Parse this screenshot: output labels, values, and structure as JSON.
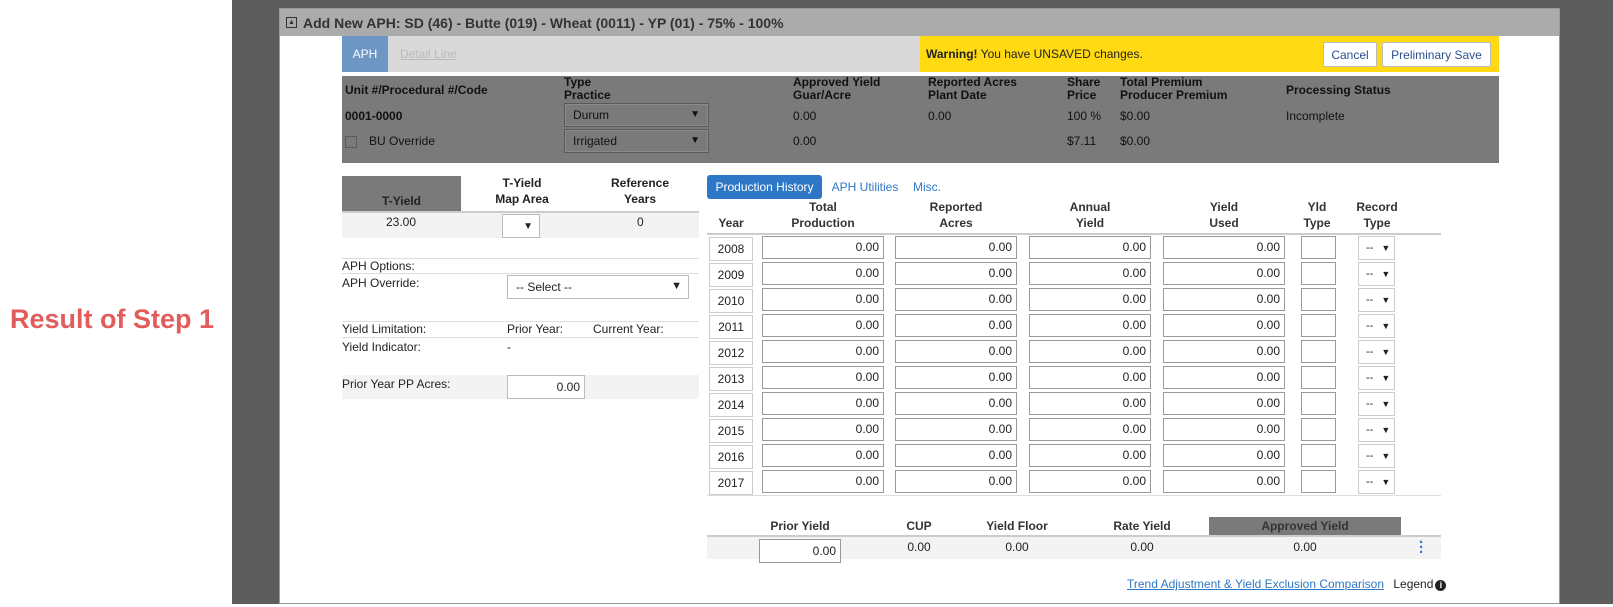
{
  "annotation": {
    "label": "Result of Step 1"
  },
  "modal": {
    "title": "Add New APH: SD (46) - Butte (019) - Wheat (0011) - YP (01) - 75% - 100%"
  },
  "tabs": {
    "aph": "APH",
    "detail_line": "Detail Line"
  },
  "warning": {
    "prefix": "Warning!",
    "message": "You have UNSAVED changes.",
    "cancel": "Cancel",
    "preliminary_save": "Preliminary Save"
  },
  "info": {
    "headers": {
      "unit": "Unit #/Procedural #/Code",
      "type": "Type",
      "practice": "Practice",
      "approved_yield": "Approved Yield",
      "guar_acre": "Guar/Acre",
      "reported_acres": "Reported Acres",
      "plant_date": "Plant Date",
      "share": "Share",
      "price": "Price",
      "total_premium": "Total Premium",
      "producer_premium": "Producer Premium",
      "processing_status": "Processing Status"
    },
    "unit_value": "0001-0000",
    "bu_override": "BU Override",
    "type_value": "Durum",
    "practice_value": "Irrigated",
    "approved_yield": "0.00",
    "guar_acre": "0.00",
    "reported_acres": "0.00",
    "share": "100 %",
    "price": "$7.11",
    "total_premium": "$0.00",
    "producer_premium": "$0.00",
    "processing_status": "Incomplete"
  },
  "left": {
    "t_yield_label": "T-Yield",
    "map_area_l1": "T-Yield",
    "map_area_l2": "Map Area",
    "ref_l1": "Reference",
    "ref_l2": "Years",
    "t_yield_value": "23.00",
    "ref_years_value": "0",
    "aph_options": "APH Options:",
    "aph_override": "APH Override:",
    "select_placeholder": "-- Select --",
    "yield_limitation": "Yield Limitation:",
    "prior_year": "Prior Year:",
    "current_year": "Current Year:",
    "yield_indicator": "Yield Indicator:",
    "yield_indicator_value": "-",
    "prior_pp_acres": "Prior Year PP Acres:",
    "prior_pp_value": "0.00"
  },
  "right": {
    "tabs": [
      "Production History",
      "APH Utilities",
      "Misc."
    ],
    "columns": {
      "year": "Year",
      "total_l1": "Total",
      "total_l2": "Production",
      "reported_l1": "Reported",
      "reported_l2": "Acres",
      "annual_l1": "Annual",
      "annual_l2": "Yield",
      "used_l1": "Yield",
      "used_l2": "Used",
      "yld_l1": "Yld",
      "yld_l2": "Type",
      "rec_l1": "Record",
      "rec_l2": "Type"
    },
    "rows": [
      {
        "year": "2008",
        "total": "0.00",
        "acres": "0.00",
        "annual": "0.00",
        "used": "0.00",
        "record": "--"
      },
      {
        "year": "2009",
        "total": "0.00",
        "acres": "0.00",
        "annual": "0.00",
        "used": "0.00",
        "record": "--"
      },
      {
        "year": "2010",
        "total": "0.00",
        "acres": "0.00",
        "annual": "0.00",
        "used": "0.00",
        "record": "--"
      },
      {
        "year": "2011",
        "total": "0.00",
        "acres": "0.00",
        "annual": "0.00",
        "used": "0.00",
        "record": "--"
      },
      {
        "year": "2012",
        "total": "0.00",
        "acres": "0.00",
        "annual": "0.00",
        "used": "0.00",
        "record": "--"
      },
      {
        "year": "2013",
        "total": "0.00",
        "acres": "0.00",
        "annual": "0.00",
        "used": "0.00",
        "record": "--"
      },
      {
        "year": "2014",
        "total": "0.00",
        "acres": "0.00",
        "annual": "0.00",
        "used": "0.00",
        "record": "--"
      },
      {
        "year": "2015",
        "total": "0.00",
        "acres": "0.00",
        "annual": "0.00",
        "used": "0.00",
        "record": "--"
      },
      {
        "year": "2016",
        "total": "0.00",
        "acres": "0.00",
        "annual": "0.00",
        "used": "0.00",
        "record": "--"
      },
      {
        "year": "2017",
        "total": "0.00",
        "acres": "0.00",
        "annual": "0.00",
        "used": "0.00",
        "record": "--"
      }
    ],
    "summary": {
      "prior_yield_label": "Prior Yield",
      "cup_label": "CUP",
      "yield_floor_label": "Yield Floor",
      "rate_yield_label": "Rate Yield",
      "approved_yield_label": "Approved Yield",
      "prior_yield": "0.00",
      "cup": "0.00",
      "yield_floor": "0.00",
      "rate_yield": "0.00",
      "approved_yield": "0.00"
    }
  },
  "footer": {
    "trend_link": "Trend Adjustment & Yield Exclusion Comparison",
    "legend": "Legend"
  }
}
